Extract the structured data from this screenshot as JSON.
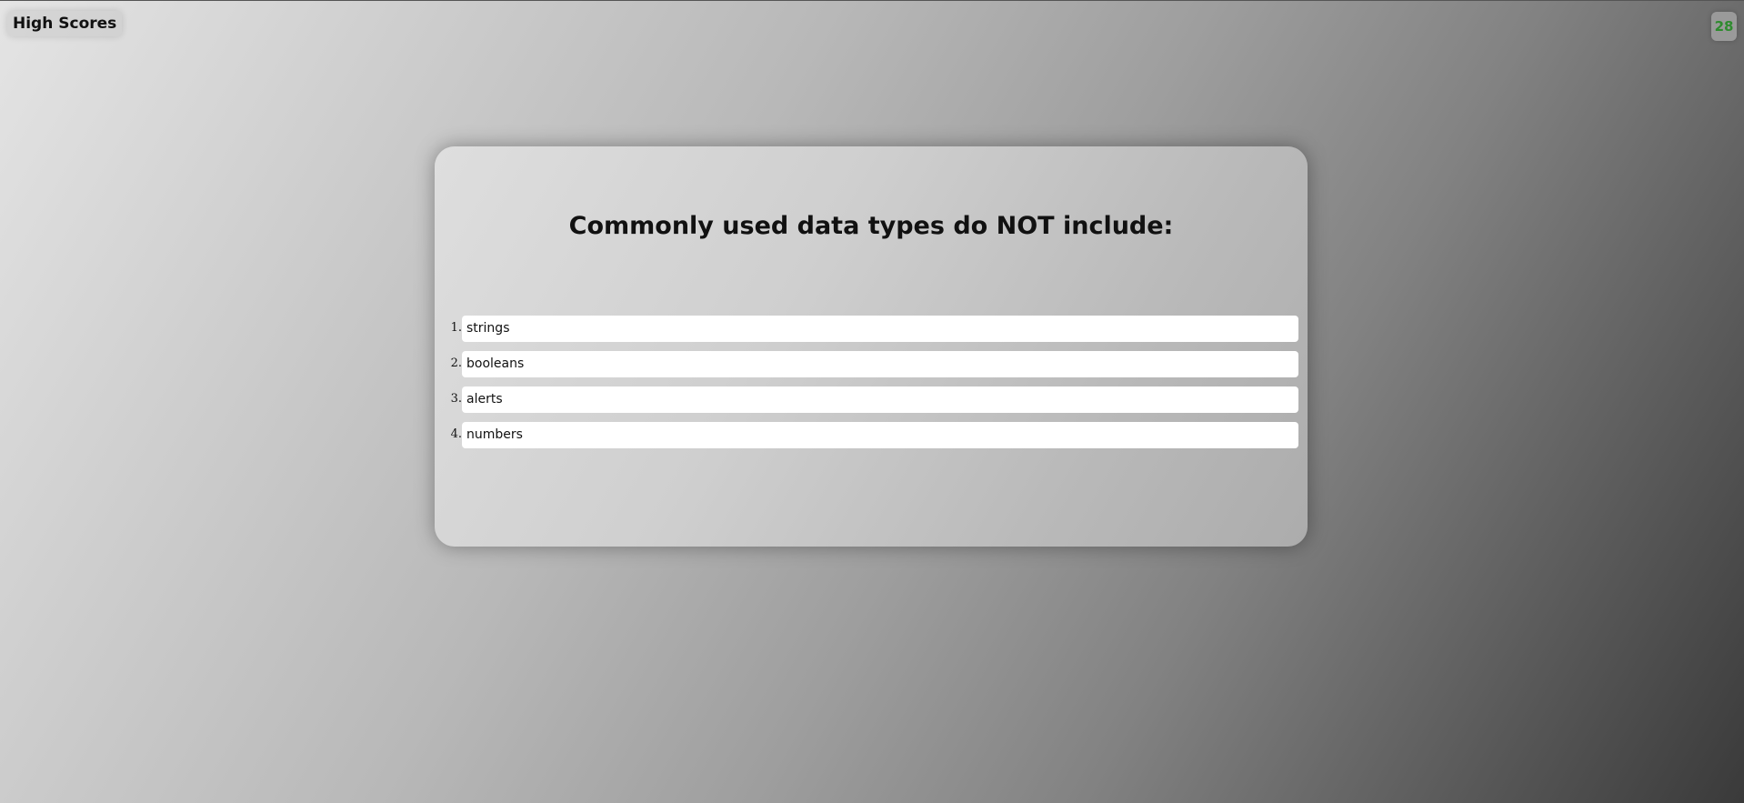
{
  "header": {
    "high_scores_label": "High Scores",
    "timer_value": "28"
  },
  "quiz": {
    "question": "Commonly used data types do NOT include:",
    "answers": [
      {
        "number": "1.",
        "label": "strings"
      },
      {
        "number": "2.",
        "label": "booleans"
      },
      {
        "number": "3.",
        "label": "alerts"
      },
      {
        "number": "4.",
        "label": "numbers"
      }
    ]
  },
  "colors": {
    "timer_text": "#2e8b2e",
    "answer_background": "#ffffff"
  }
}
